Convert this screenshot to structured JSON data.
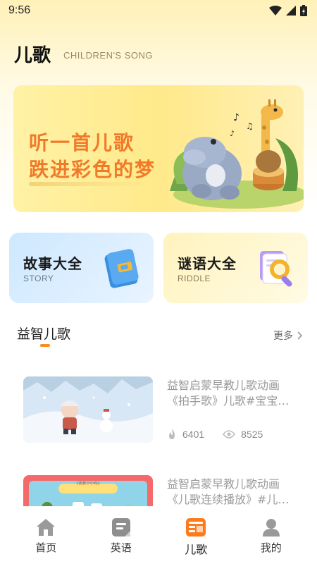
{
  "status_bar": {
    "time": "9:56"
  },
  "header": {
    "title": "儿歌",
    "subtitle": "CHILDREN'S SONG"
  },
  "banner": {
    "line1": "听一首儿歌",
    "line2": "跌进彩色的梦"
  },
  "cards": [
    {
      "title": "故事大全",
      "subtitle": "STORY",
      "icon": "book-icon"
    },
    {
      "title": "谜语大全",
      "subtitle": "RIDDLE",
      "icon": "magnifier-icon"
    }
  ],
  "section": {
    "title": "益智儿歌",
    "more": "更多"
  },
  "videos": [
    {
      "title_line1": "益智启蒙早教儿歌动画",
      "title_line2": "《拍手歌》儿歌#宝宝…",
      "likes": "6401",
      "views": "8525"
    },
    {
      "title_line1": "益智启蒙早教儿歌动画",
      "title_line2": "《儿歌连续播放》#儿…",
      "thumb_caption": "《我爱小小鸡》"
    }
  ],
  "bottom_nav": {
    "items": [
      {
        "label": "首页",
        "icon": "home-icon"
      },
      {
        "label": "英语",
        "icon": "notebook-icon"
      },
      {
        "label": "儿歌",
        "icon": "song-list-icon",
        "active": true
      },
      {
        "label": "我的",
        "icon": "profile-icon"
      }
    ]
  },
  "colors": {
    "accent": "#ff8a1e",
    "banner_text": "#f07a2a"
  }
}
